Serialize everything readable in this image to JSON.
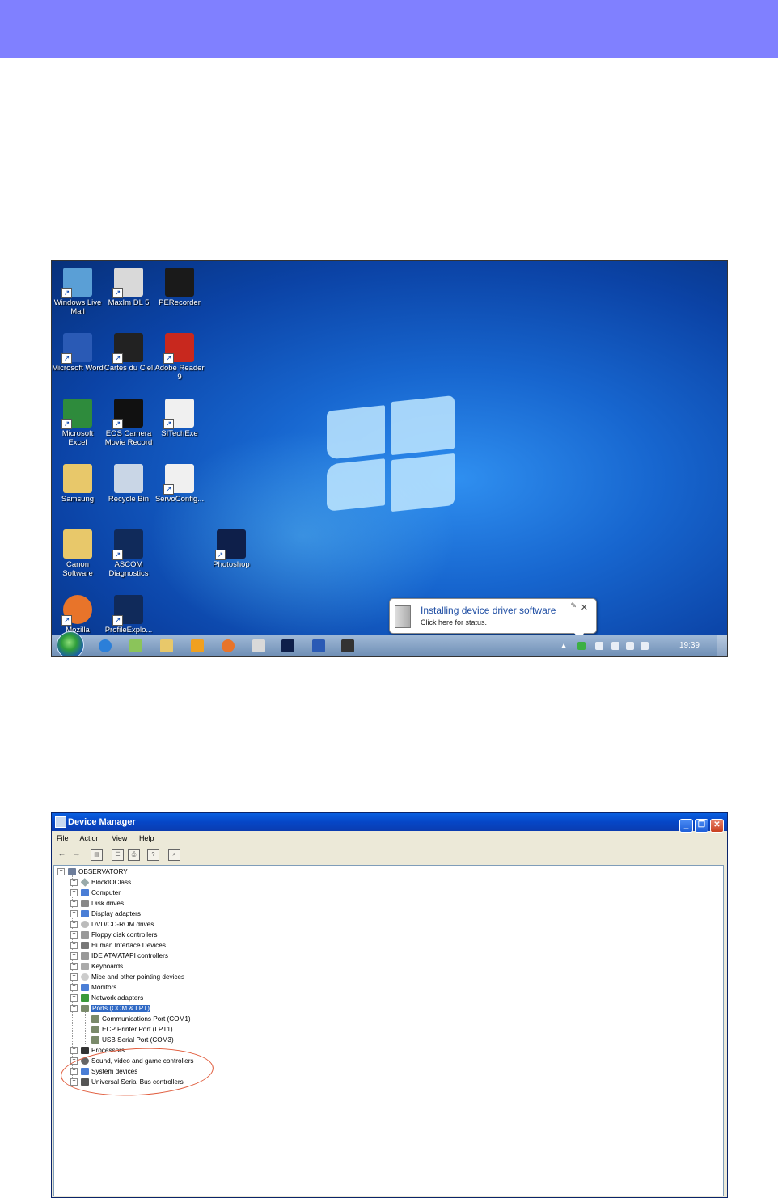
{
  "desktop": {
    "icons": [
      {
        "label": "Windows Live Mail",
        "color": "#5a9fd6"
      },
      {
        "label": "MaxIm DL 5",
        "color": "#d9d9d9"
      },
      {
        "label": "PERecorder",
        "color": "#1a1a1a"
      },
      {
        "label": "Microsoft Word",
        "color": "#2a5ab5"
      },
      {
        "label": "Cartes du Ciel",
        "color": "#222222"
      },
      {
        "label": "Adobe Reader 9",
        "color": "#c8281e"
      },
      {
        "label": "Microsoft Excel",
        "color": "#2e8b3c"
      },
      {
        "label": "EOS Camera Movie Record",
        "color": "#111111"
      },
      {
        "label": "SITechExe",
        "color": "#f0f0f0"
      },
      {
        "label": "Samsung",
        "color": "#e8c86a"
      },
      {
        "label": "Recycle Bin",
        "color": "#c9d6e6"
      },
      {
        "label": "ServoConfig...",
        "color": "#f0f0f0"
      },
      {
        "label": "Canon Software",
        "color": "#e8c86a"
      },
      {
        "label": "ASCOM Diagnostics",
        "color": "#102a5a"
      },
      {
        "label": "Photoshop",
        "color": "#0e1f4a"
      },
      {
        "label": "Mozilla",
        "color": "#e8742a"
      },
      {
        "label": "ProfileExplo...",
        "color": "#102a5a"
      }
    ],
    "notification": {
      "title": "Installing device driver software",
      "subtitle": "Click here for status."
    },
    "clock": "19:39"
  },
  "device_manager": {
    "title": "Device Manager",
    "menu": [
      "File",
      "Action",
      "View",
      "Help"
    ],
    "root": "OBSERVATORY",
    "categories": [
      "BlockIOClass",
      "Computer",
      "Disk drives",
      "Display adapters",
      "DVD/CD-ROM drives",
      "Floppy disk controllers",
      "Human Interface Devices",
      "IDE ATA/ATAPI controllers",
      "Keyboards",
      "Mice and other pointing devices",
      "Monitors",
      "Network adapters",
      "Ports (COM & LPT)",
      "Processors",
      "Sound, video and game controllers",
      "System devices",
      "Universal Serial Bus controllers"
    ],
    "ports_children": [
      "Communications Port (COM1)",
      "ECP Printer Port (LPT1)",
      "USB Serial Port (COM3)"
    ],
    "selected": "Ports (COM & LPT)"
  }
}
